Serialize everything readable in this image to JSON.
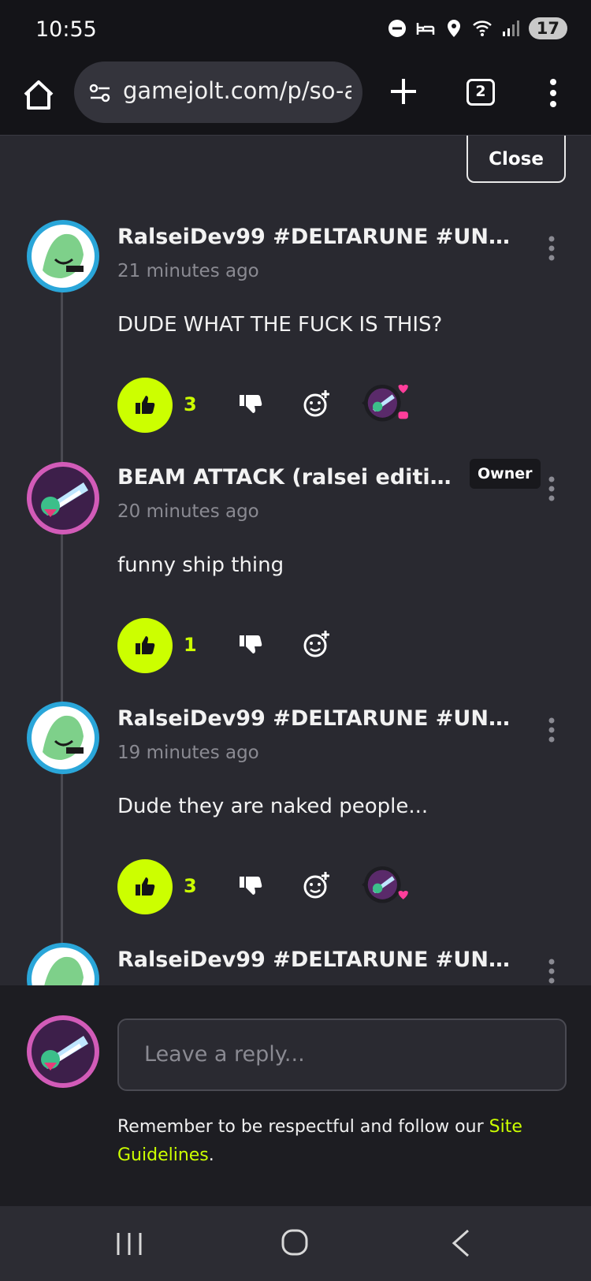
{
  "status_bar": {
    "time": "10:55",
    "battery": "17"
  },
  "browser": {
    "url": "gamejolt.com/p/so-a",
    "tab_count": "2"
  },
  "panel": {
    "close_label": "Close"
  },
  "comments": [
    {
      "author": "RalseiDev99 #DELTARUNE #UNDER...",
      "time": "21 minutes ago",
      "text": "DUDE WHAT THE FUCK IS THIS?",
      "likes": "3",
      "owner_badge": ""
    },
    {
      "author": "BEAM ATTACK (ralsei edition ...",
      "time": "20 minutes ago",
      "text": "funny ship thing",
      "likes": "1",
      "owner_badge": "Owner"
    },
    {
      "author": "RalseiDev99 #DELTARUNE #UNDER...",
      "time": "19 minutes ago",
      "text": "Dude they are naked people...",
      "likes": "3",
      "owner_badge": ""
    },
    {
      "author": "RalseiDev99 #DELTARUNE #UNDER..."
    }
  ],
  "composer": {
    "placeholder": "Leave a reply...",
    "guideline_prefix": "Remember to be respectful and follow our",
    "guideline_link": "Site Guidelines",
    "guideline_suffix": "."
  },
  "colors": {
    "accent": "#ccff00",
    "background": "#292930",
    "heart": "#ff3e9b"
  },
  "icons": [
    "home-icon",
    "site-settings-icon",
    "plus-icon",
    "tabs-icon",
    "more-vert-icon",
    "thumbs-up-icon",
    "thumbs-down-icon",
    "add-reaction-icon",
    "recents-icon",
    "nav-home-icon",
    "back-icon"
  ]
}
